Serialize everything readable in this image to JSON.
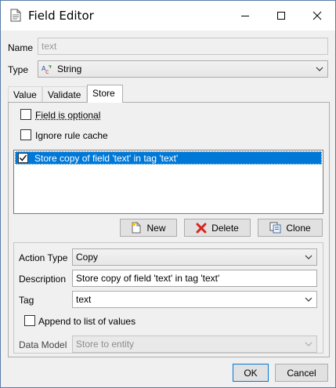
{
  "window": {
    "title": "Field Editor"
  },
  "name": {
    "label": "Name",
    "value": "text"
  },
  "type": {
    "label": "Type",
    "value": "String",
    "icon": "string-type-icon"
  },
  "tabs": [
    {
      "label": "Value",
      "active": false
    },
    {
      "label": "Validate",
      "active": false
    },
    {
      "label": "Store",
      "active": true
    }
  ],
  "store": {
    "field_optional": {
      "label": "Field is optional",
      "checked": false
    },
    "ignore_cache": {
      "label": "Ignore rule cache",
      "checked": false
    },
    "actions": [
      {
        "label": "Store copy of field 'text' in tag 'text'",
        "checked": true,
        "selected": true
      }
    ],
    "buttons": {
      "new": "New",
      "delete": "Delete",
      "clone": "Clone"
    }
  },
  "action": {
    "action_type": {
      "label": "Action Type",
      "value": "Copy"
    },
    "description": {
      "label": "Description",
      "value": "Store copy of field 'text' in tag 'text'"
    },
    "tag": {
      "label": "Tag",
      "value": "text"
    },
    "append": {
      "label": "Append to list of values",
      "checked": false
    },
    "data_model": {
      "label": "Data Model",
      "value": "Store to entity",
      "disabled": true
    }
  },
  "footer": {
    "ok": "OK",
    "cancel": "Cancel"
  }
}
